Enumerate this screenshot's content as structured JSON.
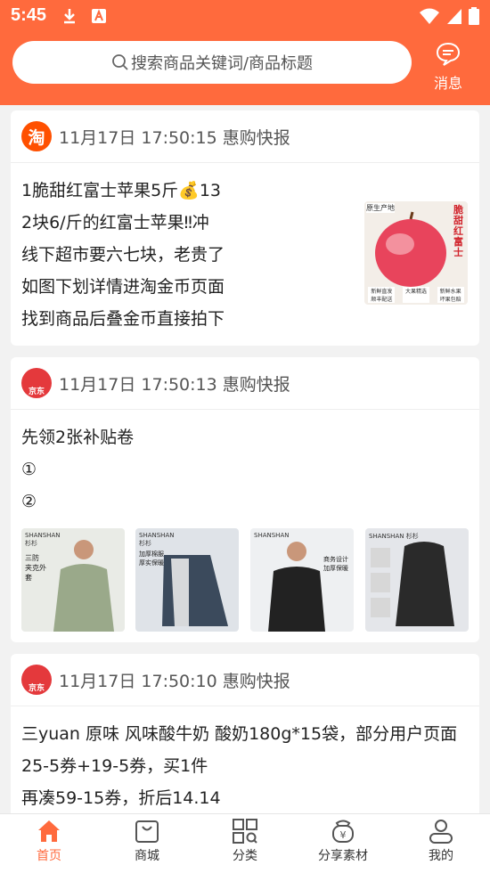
{
  "status": {
    "time": "5:45"
  },
  "search": {
    "placeholder": "搜索商品关键词/商品标题"
  },
  "header": {
    "message_label": "消息"
  },
  "posts": [
    {
      "source": "淘宝",
      "logo_text": "淘",
      "time": "11月17日 17:50:15 惠购快报",
      "lines": [
        "1脆甜红富士苹果5斤💰13",
        "2块6/斤的红富士苹果‼冲",
        "线下超市要六七块，老贵了",
        "如图下划详情进淘金币页面",
        "找到商品后叠金币直接拍下"
      ],
      "image_badges": [
        "原生产地",
        "脆甜红富士"
      ],
      "image_bottom_labels": [
        "新鲜直发 顺丰配送",
        "大果精选",
        "新鲜水果 坏果包赔"
      ]
    },
    {
      "source": "京东",
      "logo_text": "京东",
      "time": "11月17日 17:50:13 惠购快报",
      "lines": [
        "先领2张补贴卷",
        "①",
        "②"
      ],
      "thumbs": [
        {
          "brand": "SHANSHAN 杉杉",
          "caption": "三防 夹克外套"
        },
        {
          "brand": "SHANSHAN 杉杉",
          "caption": "加厚棉服 厚实保暖"
        },
        {
          "brand": "SHANSHAN",
          "caption": "商务设计 加厚保暖"
        },
        {
          "brand": "SHANSHAN 杉杉",
          "caption": ""
        }
      ]
    },
    {
      "source": "京东",
      "logo_text": "京东",
      "time": "11月17日 17:50:10 惠购快报",
      "lines": [
        "三yuan 原味 风味酸牛奶 酸奶180g*15袋，部分用户页面",
        "25-5券+19-5券，买1件",
        "再凑59-15券，折后14.14"
      ]
    }
  ],
  "tabs": [
    {
      "label": "首页",
      "icon": "home-icon",
      "active": true
    },
    {
      "label": "商城",
      "icon": "bag-icon",
      "active": false
    },
    {
      "label": "分类",
      "icon": "grid-icon",
      "active": false
    },
    {
      "label": "分享素材",
      "icon": "share-material-icon",
      "active": false
    },
    {
      "label": "我的",
      "icon": "user-icon",
      "active": false
    }
  ],
  "colors": {
    "accent": "#ff6a3d",
    "taobao": "#ff5000",
    "jd": "#e4393c"
  }
}
